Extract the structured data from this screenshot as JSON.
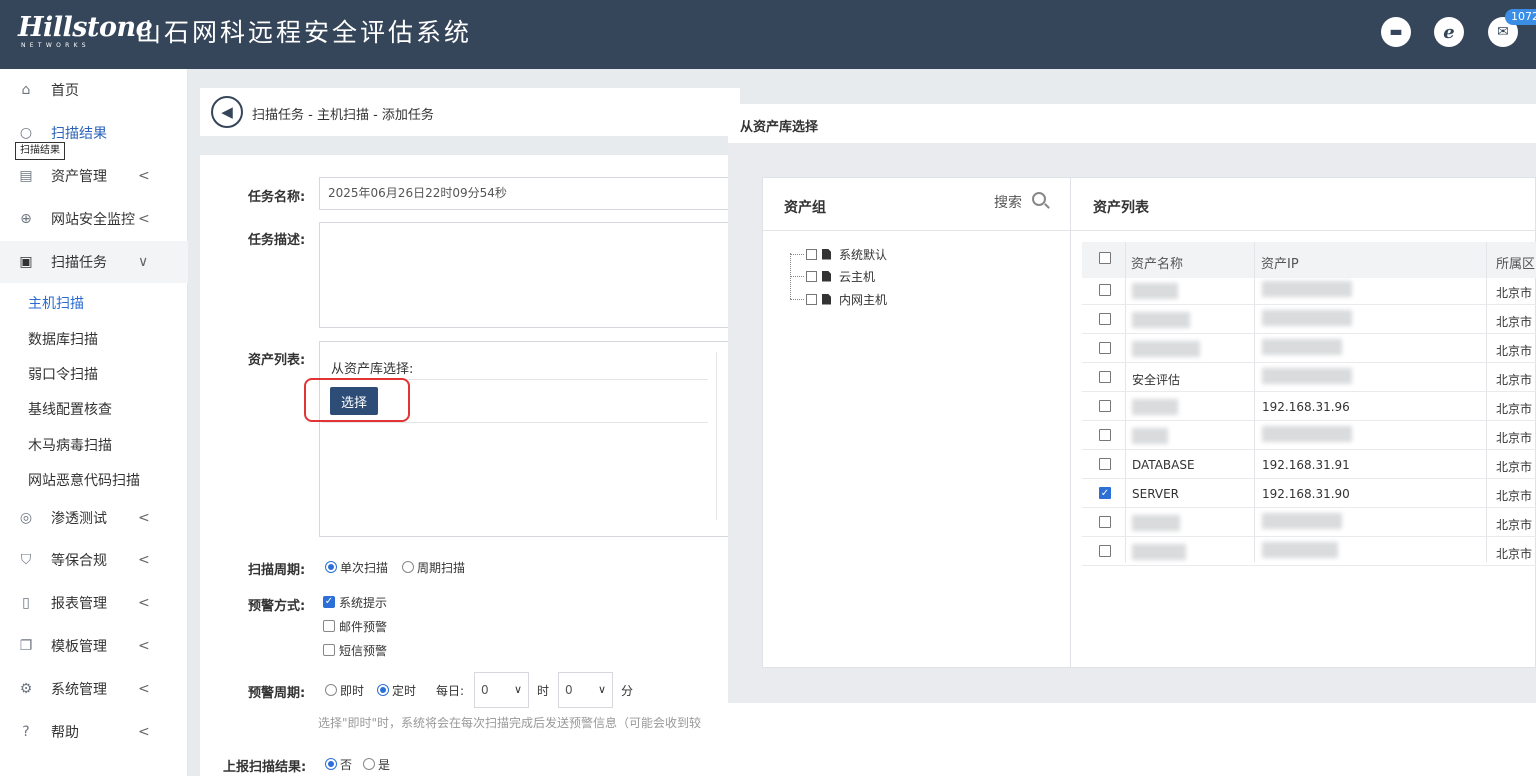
{
  "header": {
    "brand": "Hillstone",
    "brand_sub": "NETWORKS",
    "title": "山石网科远程安全评估系统",
    "mail_count": "1072"
  },
  "sidebar": {
    "tooltip": "扫描结果",
    "items": [
      {
        "label": "首页"
      },
      {
        "label": "扫描结果"
      },
      {
        "label": "资产管理"
      },
      {
        "label": "网站安全监控"
      },
      {
        "label": "扫描任务"
      },
      {
        "label": "渗透测试"
      },
      {
        "label": "等保合规"
      },
      {
        "label": "报表管理"
      },
      {
        "label": "模板管理"
      },
      {
        "label": "系统管理"
      },
      {
        "label": "帮助"
      }
    ],
    "sub_items": [
      {
        "label": "主机扫描"
      },
      {
        "label": "数据库扫描"
      },
      {
        "label": "弱口令扫描"
      },
      {
        "label": "基线配置核查"
      },
      {
        "label": "木马病毒扫描"
      },
      {
        "label": "网站恶意代码扫描"
      }
    ]
  },
  "breadcrumb": "扫描任务 - 主机扫描 - 添加任务",
  "form": {
    "task_name_label": "任务名称:",
    "task_name_value": "2025年06月26日22时09分54秒",
    "task_desc_label": "任务描述:",
    "asset_list_label": "资产列表:",
    "asset_from_lib": "从资产库选择:",
    "select_button": "选择",
    "scan_cycle_label": "扫描周期:",
    "scan_single": "单次扫描",
    "scan_periodic": "周期扫描",
    "alert_method_label": "预警方式:",
    "alert_system": "系统提示",
    "alert_email": "邮件预警",
    "alert_sms": "短信预警",
    "alert_cycle_label": "预警周期:",
    "alert_instant": "即时",
    "alert_timed": "定时",
    "daily": "每日:",
    "hour_value": "0",
    "hour_unit": "时",
    "minute_value": "0",
    "minute_unit": "分",
    "hint": "选择\"即时\"时，系统将会在每次扫描完成后发送预警信息（可能会收到较",
    "report_label": "上报扫描结果:",
    "report_no": "否",
    "report_yes": "是"
  },
  "modal": {
    "title": "从资产库选择",
    "group_header": "资产组",
    "search": "搜索",
    "list_header": "资产列表",
    "groups": [
      {
        "label": "系统默认"
      },
      {
        "label": "云主机"
      },
      {
        "label": "内网主机"
      }
    ],
    "columns": {
      "name": "资产名称",
      "ip": "资产IP",
      "region": "所属区"
    },
    "rows": [
      {
        "name": "",
        "ip": "",
        "region": "北京市",
        "checked": false
      },
      {
        "name": "",
        "ip": "",
        "region": "北京市",
        "checked": false
      },
      {
        "name": "",
        "ip": "",
        "region": "北京市",
        "checked": false
      },
      {
        "name": "安全评估",
        "ip": "",
        "region": "北京市",
        "checked": false
      },
      {
        "name": "",
        "ip": "192.168.31.96",
        "region": "北京市",
        "checked": false
      },
      {
        "name": "",
        "ip": "",
        "region": "北京市",
        "checked": false
      },
      {
        "name": "DATABASE",
        "ip": "192.168.31.91",
        "region": "北京市",
        "checked": false
      },
      {
        "name": "SERVER",
        "ip": "192.168.31.90",
        "region": "北京市",
        "checked": true
      },
      {
        "name": "",
        "ip": "",
        "region": "北京市",
        "checked": false
      },
      {
        "name": "",
        "ip": "",
        "region": "北京市",
        "checked": false
      }
    ]
  }
}
